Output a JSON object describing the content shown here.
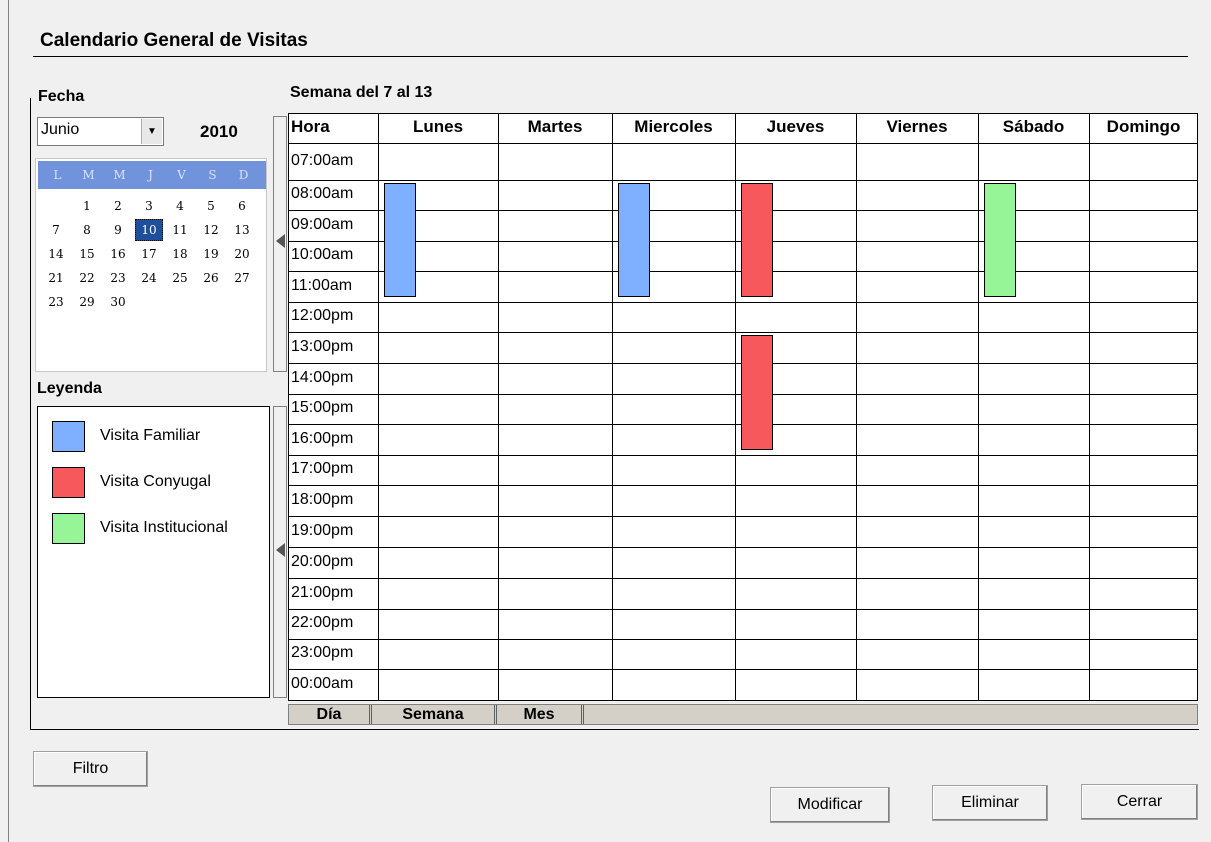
{
  "title": "Calendario General  de Visitas",
  "date_panel": {
    "label": "Fecha",
    "month": "Junio",
    "year": "2010",
    "weekday_initials": [
      "L",
      "M",
      "M",
      "J",
      "V",
      "S",
      "D"
    ],
    "weeks": [
      [
        "",
        "1",
        "2",
        "3",
        "4",
        "5",
        "6"
      ],
      [
        "7",
        "8",
        "9",
        "10",
        "11",
        "12",
        "13"
      ],
      [
        "14",
        "15",
        "16",
        "17",
        "18",
        "19",
        "20"
      ],
      [
        "21",
        "22",
        "23",
        "24",
        "25",
        "26",
        "27"
      ],
      [
        "23",
        "29",
        "30",
        "",
        "",
        "",
        ""
      ]
    ],
    "selected_day": "10"
  },
  "legend": {
    "label": "Leyenda",
    "items": [
      {
        "label": "Visita Familiar",
        "color": "#7fb0ff"
      },
      {
        "label": "Visita Conyugal",
        "color": "#f6585c"
      },
      {
        "label": "Visita Institucional",
        "color": "#96f596"
      }
    ]
  },
  "schedule": {
    "week_label": "Semana del 7 al 13",
    "hour_header": "Hora",
    "days": [
      "Lunes",
      "Martes",
      "Miercoles",
      "Jueves",
      "Viernes",
      "Sábado",
      "Domingo"
    ],
    "hours": [
      "07:00am",
      "08:00am",
      "09:00am",
      "10:00am",
      "11:00am",
      "12:00pm",
      "13:00pm",
      "14:00pm",
      "15:00pm",
      "16:00pm",
      "17:00pm",
      "18:00pm",
      "19:00pm",
      "20:00pm",
      "21:00pm",
      "22:00pm",
      "23:00pm",
      "00:00am"
    ],
    "events": [
      {
        "day": "Lunes",
        "start": "08:00am",
        "end": "11:00am",
        "type": "Visita Familiar",
        "color": "#7fb0ff"
      },
      {
        "day": "Miercoles",
        "start": "08:00am",
        "end": "11:00am",
        "type": "Visita Familiar",
        "color": "#7fb0ff"
      },
      {
        "day": "Jueves",
        "start": "08:00am",
        "end": "11:00am",
        "type": "Visita Conyugal",
        "color": "#f6585c"
      },
      {
        "day": "Jueves",
        "start": "13:00pm",
        "end": "16:00pm",
        "type": "Visita Conyugal",
        "color": "#f6585c"
      },
      {
        "day": "Sábado",
        "start": "08:00am",
        "end": "11:00am",
        "type": "Visita Institucional",
        "color": "#96f596"
      }
    ],
    "view_tabs": [
      "Día",
      "Semana",
      "Mes"
    ]
  },
  "buttons": {
    "filter": "Filtro",
    "modify": "Modificar",
    "delete": "Eliminar",
    "close": "Cerrar"
  }
}
